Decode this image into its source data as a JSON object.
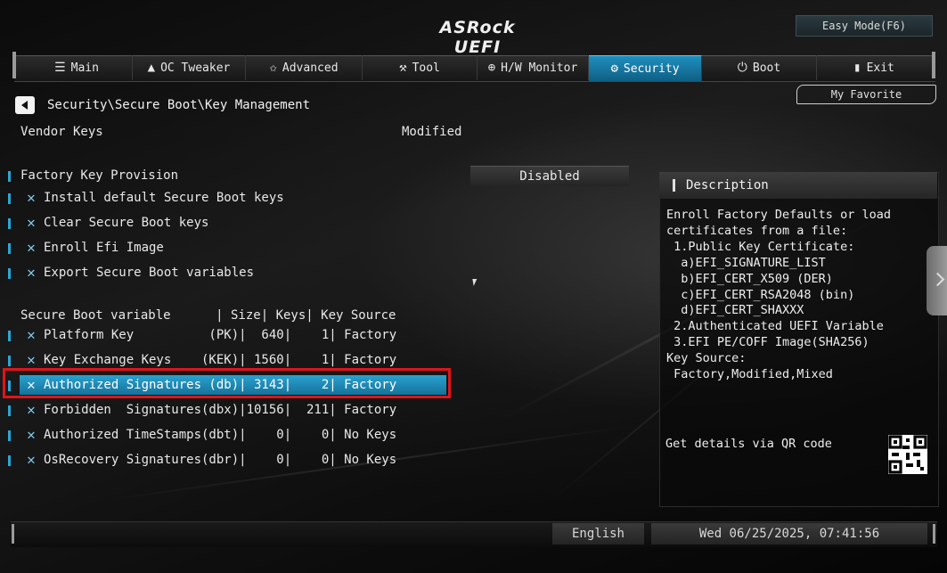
{
  "header": {
    "logo": "ASRock UEFI",
    "easy_mode": "Easy Mode(F6)",
    "favorite": "My Favorite"
  },
  "nav": {
    "tabs": [
      {
        "label": "Main",
        "icon": "list-icon",
        "glyph": "☰"
      },
      {
        "label": "OC Tweaker",
        "icon": "rocket-icon",
        "glyph": "🚀"
      },
      {
        "label": "Advanced",
        "icon": "star-icon",
        "glyph": "✩"
      },
      {
        "label": "Tool",
        "icon": "tool-icon",
        "glyph": "✕"
      },
      {
        "label": "H/W Monitor",
        "icon": "crosshair-icon",
        "glyph": "⊕"
      },
      {
        "label": "Security",
        "icon": "shield-icon",
        "glyph": "◉"
      },
      {
        "label": "Boot",
        "icon": "power-icon",
        "glyph": "⏻"
      },
      {
        "label": "Exit",
        "icon": "exit-icon",
        "glyph": "⎘"
      }
    ],
    "active_tab": "Security"
  },
  "breadcrumb": "Security\\Secure Boot\\Key Management",
  "vendor_keys": {
    "label": "Vendor Keys",
    "value": "Modified"
  },
  "factory_key_provision": {
    "label": "Factory Key Provision",
    "value": "Disabled"
  },
  "actions": [
    "Install default Secure Boot keys",
    "Clear Secure Boot keys",
    "Enroll Efi Image",
    "Export Secure Boot variables"
  ],
  "table": {
    "header": "Secure Boot variable      | Size| Keys| Key Source",
    "rows": [
      "Platform Key          (PK)|  640|    1| Factory",
      "Key Exchange Keys    (KEK)| 1560|    1| Factory",
      "Authorized Signatures (db)| 3143|    2| Factory",
      "Forbidden  Signatures(dbx)|10156|  211| Factory",
      "Authorized TimeStamps(dbt)|    0|    0| No Keys",
      "OsRecovery Signatures(dbr)|    0|    0| No Keys"
    ],
    "selected_row": 2
  },
  "description": {
    "title": "Description",
    "body": "Enroll Factory Defaults or load\ncertificates from a file:\n 1.Public Key Certificate:\n  a)EFI_SIGNATURE_LIST\n  b)EFI_CERT_X509 (DER)\n  c)EFI_CERT_RSA2048 (bin)\n  d)EFI_CERT_SHAXXX\n 2.Authenticated UEFI Variable\n 3.EFI PE/COFF Image(SHA256)\nKey Source:\n Factory,Modified,Mixed",
    "qr_label": "Get details via QR code"
  },
  "footer": {
    "language": "English",
    "datetime": "Wed 06/25/2025, 07:41:56"
  },
  "colors": {
    "accent": "#1f8fbf",
    "highlight_border": "#e0141a"
  }
}
